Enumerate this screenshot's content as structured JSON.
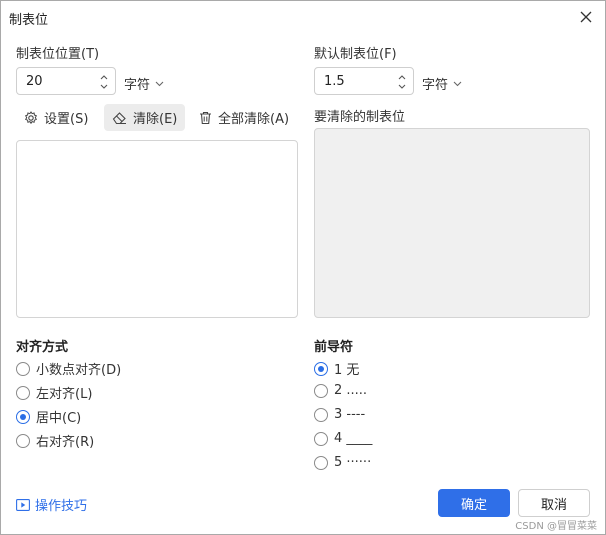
{
  "window": {
    "title": "制表位"
  },
  "tab_position": {
    "label": "制表位位置(T)",
    "value": "20",
    "unit": "字符"
  },
  "default_tab": {
    "label": "默认制表位(F)",
    "value": "1.5",
    "unit": "字符"
  },
  "toolbar": {
    "set_label": "设置(S)",
    "clear_label": "清除(E)",
    "clear_all_label": "全部清除(A)"
  },
  "to_clear": {
    "label": "要清除的制表位"
  },
  "alignment": {
    "title": "对齐方式",
    "options": [
      "小数点对齐(D)",
      "左对齐(L)",
      "居中(C)",
      "右对齐(R)"
    ],
    "selected_index": 2
  },
  "leader": {
    "title": "前导符",
    "options": [
      "1 无",
      "2 .....",
      "3 ----",
      "4 ____",
      "5  ······"
    ],
    "selected_index": 0
  },
  "footer": {
    "tips_label": "操作技巧",
    "ok_label": "确定",
    "cancel_label": "取消"
  },
  "watermark": "CSDN @冒冒菜菜",
  "colors": {
    "accent": "#2f6fe8",
    "disabled_bg": "#f0f0f0",
    "active_button_bg": "#ececec"
  }
}
